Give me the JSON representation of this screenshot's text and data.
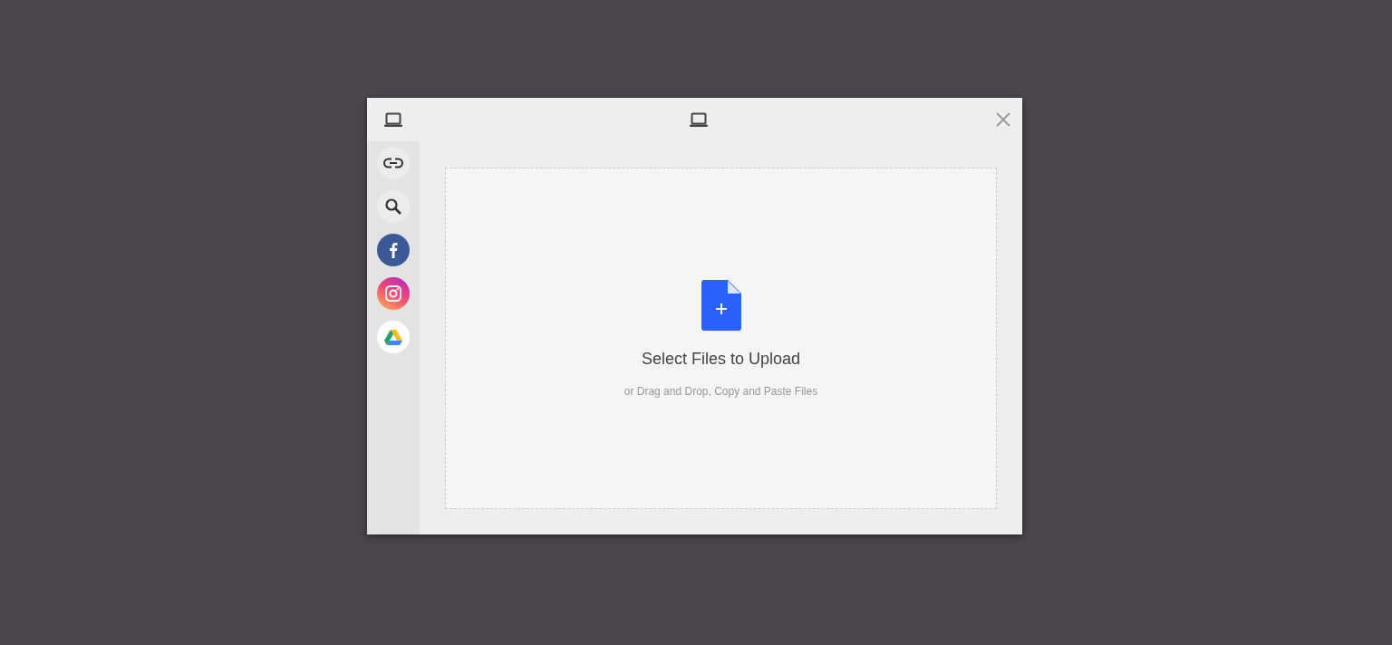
{
  "sources": [
    {
      "kind": "link"
    },
    {
      "kind": "search"
    },
    {
      "kind": "facebook"
    },
    {
      "kind": "instagram"
    },
    {
      "kind": "drive"
    }
  ],
  "dropzone": {
    "title": "Select Files to Upload",
    "subtitle": "or Drag and Drop, Copy and Paste Files"
  }
}
